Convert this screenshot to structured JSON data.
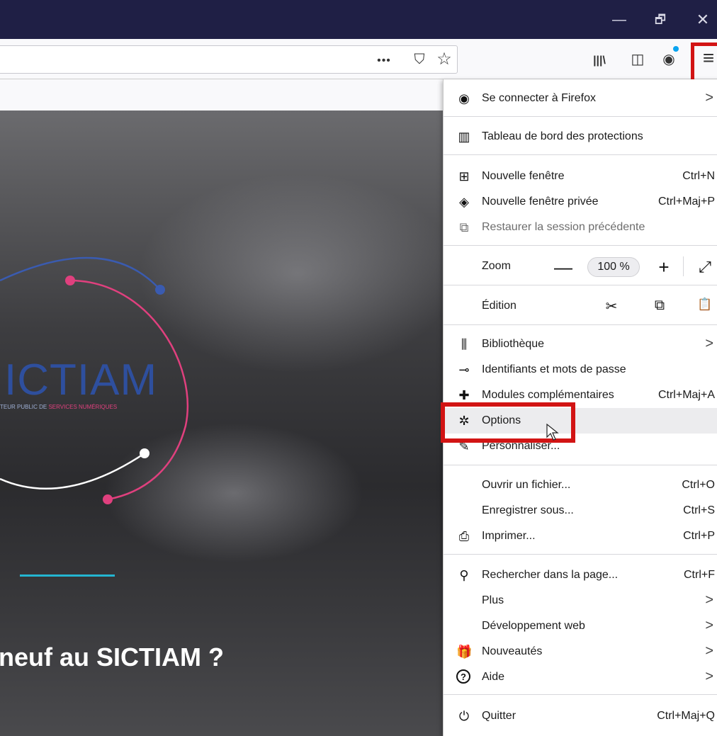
{
  "window": {
    "minimize_glyph": "—",
    "maximize_glyph": "🗗",
    "close_glyph": "✕"
  },
  "toolbar": {
    "page_actions_glyph": "•••",
    "pocket_glyph": "⛉",
    "star_glyph": "☆",
    "library_glyph": "|||\\",
    "sidebar_glyph": "◫",
    "account_glyph": "◉",
    "menu_glyph": "≡"
  },
  "page": {
    "brand": "ICTIAM",
    "brand_sub_a": "TEUR PUBLIC DE ",
    "brand_sub_b": "SERVICES NUMÉRIQUES",
    "headline": "neuf au SICTIAM ?"
  },
  "menu": {
    "sign_in": "Se connecter à Firefox",
    "protections": "Tableau de bord des protections",
    "new_window": "Nouvelle fenêtre",
    "new_window_sc": "Ctrl+N",
    "private_window": "Nouvelle fenêtre privée",
    "private_window_sc": "Ctrl+Maj+P",
    "restore_session": "Restaurer la session précédente",
    "zoom_label": "Zoom",
    "zoom_minus": "—",
    "zoom_value": "100 %",
    "zoom_plus": "+",
    "fullscreen_glyph": "⤢",
    "edit_label": "Édition",
    "cut_glyph": "✂",
    "copy_glyph": "⧉",
    "paste_glyph": "📋",
    "library": "Bibliothèque",
    "logins": "Identifiants et mots de passe",
    "addons": "Modules complémentaires",
    "addons_sc": "Ctrl+Maj+A",
    "options": "Options",
    "customize": "Personnaliser...",
    "open_file": "Ouvrir un fichier...",
    "open_file_sc": "Ctrl+O",
    "save_as": "Enregistrer sous...",
    "save_as_sc": "Ctrl+S",
    "print": "Imprimer...",
    "print_sc": "Ctrl+P",
    "find": "Rechercher dans la page...",
    "find_sc": "Ctrl+F",
    "more": "Plus",
    "web_dev": "Développement web",
    "whats_new": "Nouveautés",
    "help": "Aide",
    "quit": "Quitter",
    "quit_sc": "Ctrl+Maj+Q",
    "arrow_glyph": ">"
  },
  "icons": {
    "account": "◉",
    "protections": "▥",
    "new_window": "⊞",
    "private": "◈",
    "restore": "⧉",
    "library": "⫼",
    "logins": "⊸",
    "addons": "✚",
    "options": "✲",
    "customize": "✎",
    "print": "⎙",
    "find": "⚲",
    "whats_new": "🎁",
    "help": "?",
    "quit": "⏻"
  }
}
